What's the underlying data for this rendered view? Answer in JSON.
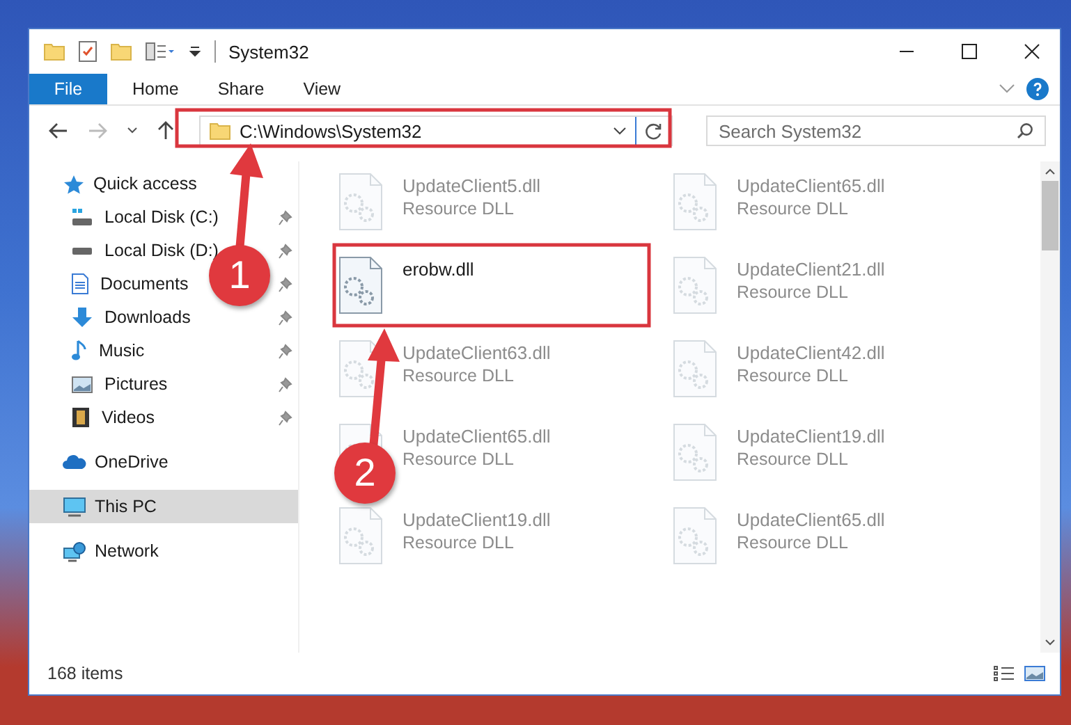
{
  "window": {
    "title": "System32"
  },
  "ribbon": {
    "tabs": [
      {
        "label": "File",
        "kind": "file",
        "selected": false
      },
      {
        "label": "Home",
        "kind": "tab",
        "selected": false
      },
      {
        "label": "Share",
        "kind": "tab",
        "selected": false
      },
      {
        "label": "View",
        "kind": "tab",
        "selected": false
      }
    ]
  },
  "address": {
    "value": "C:\\Windows\\System32"
  },
  "search": {
    "placeholder": "Search System32"
  },
  "sidebar": {
    "items": [
      {
        "label": "Quick access",
        "selected": false,
        "children": [
          {
            "label": "Local Disk (C:)",
            "pinned": true,
            "selected": false
          },
          {
            "label": "Local Disk (D:)",
            "pinned": true,
            "selected": false
          },
          {
            "label": "Documents",
            "pinned": true,
            "selected": false
          },
          {
            "label": "Downloads",
            "pinned": true,
            "selected": false
          },
          {
            "label": "Music",
            "pinned": true,
            "selected": false
          },
          {
            "label": "Pictures",
            "pinned": true,
            "selected": false
          },
          {
            "label": "Videos",
            "pinned": true,
            "selected": false
          }
        ]
      },
      {
        "label": "OneDrive",
        "selected": false
      },
      {
        "label": "This PC",
        "selected": true
      },
      {
        "label": "Network",
        "selected": false
      }
    ]
  },
  "files": [
    {
      "name": "UpdateClient5.dll",
      "type": "Resource DLL",
      "dimmed": true
    },
    {
      "name": "UpdateClient65.dll",
      "type": "Resource DLL",
      "dimmed": true
    },
    {
      "name": "erobw.dll",
      "dimmed": false
    },
    {
      "name": "UpdateClient21.dll",
      "type": "Resource DLL",
      "dimmed": true
    },
    {
      "name": "UpdateClient63.dll",
      "type": "Resource DLL",
      "dimmed": true
    },
    {
      "name": "UpdateClient42.dll",
      "type": "Resource DLL",
      "dimmed": true
    },
    {
      "name": "UpdateClient65.dll",
      "type": "Resource DLL",
      "dimmed": true
    },
    {
      "name": "UpdateClient19.dll",
      "type": "Resource DLL",
      "dimmed": true
    },
    {
      "name": "UpdateClient19.dll",
      "type": "Resource DLL",
      "dimmed": true
    },
    {
      "name": "UpdateClient65.dll",
      "type": "Resource DLL",
      "dimmed": true
    }
  ],
  "status_bar": {
    "count": "168 items"
  },
  "annotations": [
    {
      "label": "1"
    },
    {
      "label": "2"
    }
  ]
}
